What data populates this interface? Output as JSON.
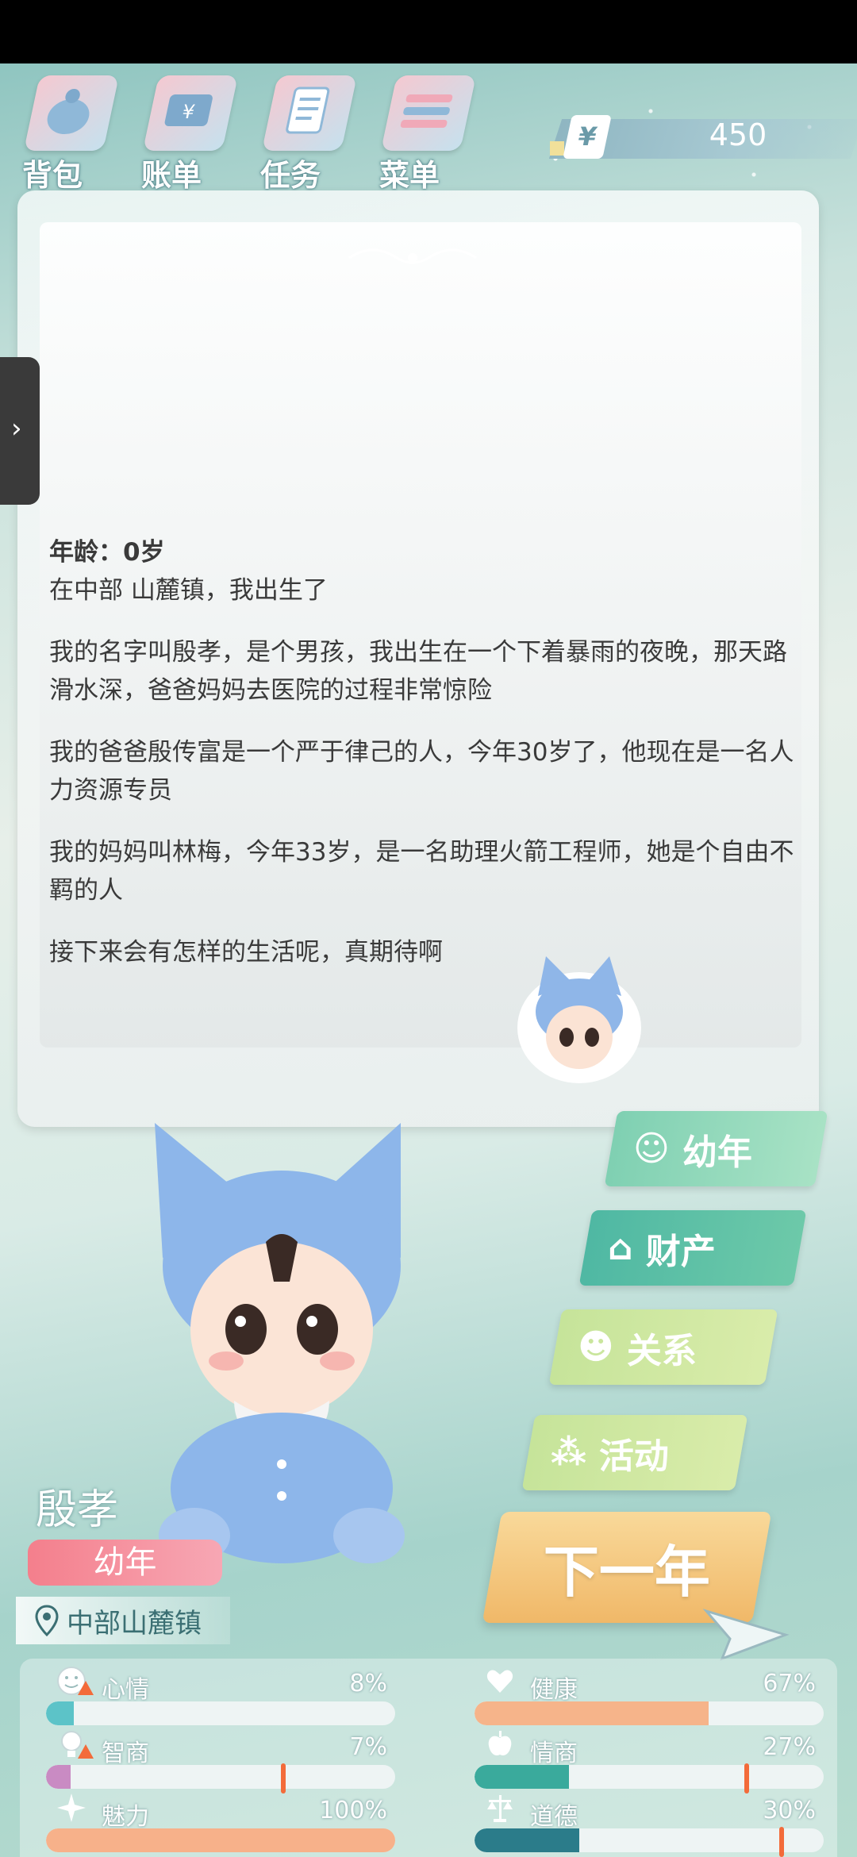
{
  "topnav": {
    "items": [
      {
        "label": "背包",
        "icon": "backpack-icon"
      },
      {
        "label": "账单",
        "icon": "bill-icon"
      },
      {
        "label": "任务",
        "icon": "task-icon"
      },
      {
        "label": "菜单",
        "icon": "menu-icon"
      }
    ],
    "money_symbol": "¥",
    "money": "450"
  },
  "story": {
    "age": "年龄：0岁",
    "born": "在中部 山麓镇，我出生了",
    "p1": "我的名字叫殷孝，是个男孩，我出生在一个下着暴雨的夜晚，那天路滑水深，爸爸妈妈去医院的过程非常惊险",
    "p2": "我的爸爸殷传富是一个严于律己的人，今年30岁了，他现在是一名人力资源专员",
    "p3": "我的妈妈叫林梅，今年33岁，是一名助理火箭工程师，她是个自由不羁的人",
    "p4": "接下来会有怎样的生活呢，真期待啊"
  },
  "side_menu": {
    "stage_btn": "幼年",
    "property_btn": "财产",
    "relations_btn": "关系",
    "activity_btn": "活动",
    "next_year_btn": "下一年"
  },
  "character": {
    "name": "殷孝",
    "stage": "幼年",
    "location": "中部山麓镇"
  },
  "stats": {
    "mood": {
      "label": "心情",
      "value": "8%",
      "level": 0.08,
      "color": "#5cc3c8",
      "warning": true
    },
    "health": {
      "label": "健康",
      "value": "67%",
      "level": 0.67,
      "color": "#f6b48a"
    },
    "iq": {
      "label": "智商",
      "value": "7%",
      "level": 0.07,
      "color": "#c98bc3",
      "warning": true,
      "threshold": 0.68
    },
    "eq": {
      "label": "情商",
      "value": "27%",
      "level": 0.27,
      "color": "#3aaa9c",
      "threshold": 0.78
    },
    "charm": {
      "label": "魅力",
      "value": "100%",
      "level": 1.0,
      "color": "#f7b18a"
    },
    "moral": {
      "label": "道德",
      "value": "30%",
      "level": 0.3,
      "color": "#2b7c8a",
      "threshold": 0.88
    }
  }
}
